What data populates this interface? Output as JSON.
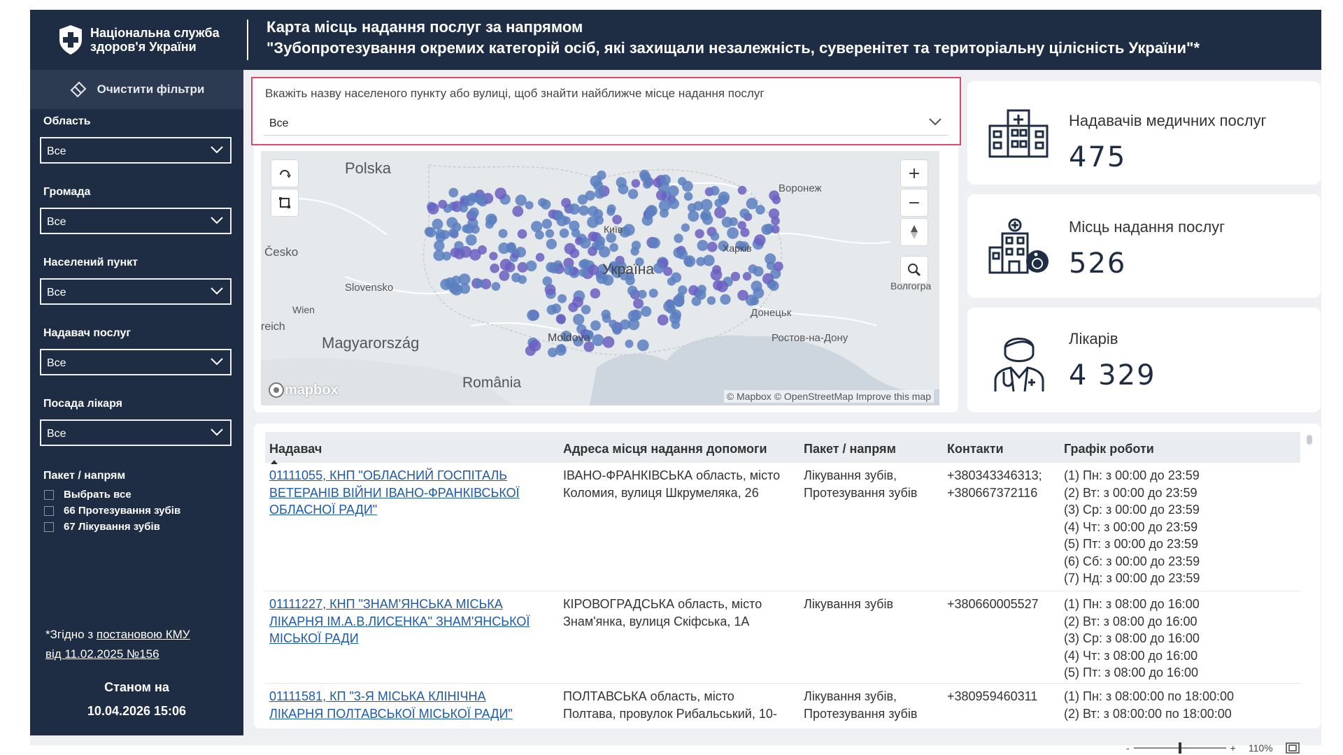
{
  "header": {
    "org_name_line1": "Національна служба",
    "org_name_line2": "здоров'я України",
    "title_line1": "Карта місць надання послуг за напрямом",
    "title_line2": "\"Зубопротезування окремих категорій осіб, які захищали незалежність, суверенітет та територіальну цілісність України\"*"
  },
  "sidebar": {
    "clear_filters": "Очистити фільтри",
    "filters": [
      {
        "label": "Область",
        "value": "Все"
      },
      {
        "label": "Громада",
        "value": "Все"
      },
      {
        "label": "Населений пункт",
        "value": "Все"
      },
      {
        "label": "Надавач послуг",
        "value": "Все"
      },
      {
        "label": "Посада лікаря",
        "value": "Все"
      }
    ],
    "package_label": "Пакет / напрям",
    "package_options": [
      "Выбрать все",
      "66 Протезування зубів",
      "67 Лікування зубів"
    ],
    "note_prefix": "*Згідно з ",
    "note_link_line1": "постановою КМУ",
    "note_link_line2": "від 11.02.2025 №156",
    "asof_label": "Станом на",
    "asof_value": "10.04.2026 15:06"
  },
  "search": {
    "label": "Вкажіть назву населеного пункту або вулиці, щоб знайти найближче місце надання послуг",
    "value": "Все"
  },
  "map": {
    "labels": [
      "Polska",
      "Česko",
      "Slovensko",
      "Wien",
      "reich",
      "Magyarország",
      "România",
      "Moldova",
      "Україна",
      "Київ",
      "Харків",
      "Воронеж",
      "Донецьк",
      "Ростов-на-Дону",
      "Волгогра"
    ],
    "attribution": "© Mapbox © OpenStreetMap  Improve this map",
    "brand": "mapbox",
    "dot_color": "#5b7fbf",
    "dot_color_alt": "#6a5fc2"
  },
  "kpis": [
    {
      "label": "Надавачів медичних послуг",
      "value": "475",
      "icon": "hospital-icon"
    },
    {
      "label": "Місць надання послуг",
      "value": "526",
      "icon": "clinic-accessible-icon"
    },
    {
      "label": "Лікарів",
      "value": "4 329",
      "icon": "doctor-icon"
    }
  ],
  "table": {
    "columns": [
      "Надавач",
      "Адреса місця надання допомоги",
      "Пакет / напрям",
      "Контакти",
      "Графік роботи"
    ],
    "rows": [
      {
        "provider": [
          "01111055, КНП \"ОБЛАСНИЙ ГОСПІТАЛЬ",
          "ВЕТЕРАНІВ ВІЙНИ ІВАНО-ФРАНКІВСЬКОЇ",
          "ОБЛАСНОЇ РАДИ\""
        ],
        "address": [
          "ІВАНО-ФРАНКІВСЬКА область, місто",
          "Коломия, вулиця Шкрумеляка, 26"
        ],
        "package": [
          "Лікування зубів,",
          "Протезування зубів"
        ],
        "contacts": [
          "+380343346313;",
          "+380667372116"
        ],
        "schedule": [
          "(1) Пн: з 00:00 до 23:59",
          "(2) Вт: з 00:00 до 23:59",
          "(3) Ср: з 00:00 до 23:59",
          "(4) Чт: з 00:00 до 23:59",
          "(5) Пт: з 00:00 до 23:59",
          "(6) Сб: з 00:00 до 23:59",
          "(7) Нд: з 00:00 до 23:59"
        ]
      },
      {
        "provider": [
          "01111227, КНП \"ЗНАМ'ЯНСЬКА МІСЬКА",
          "ЛІКАРНЯ ІМ.А.В.ЛИСЕНКА\" ЗНАМ'ЯНСЬКОЇ",
          "МІСЬКОЇ РАДИ"
        ],
        "address": [
          "КІРОВОГРАДСЬКА область, місто",
          "Знам'янка, вулиця Скіфська, 1А"
        ],
        "package": [
          "Лікування зубів"
        ],
        "contacts": [
          "+380660005527"
        ],
        "schedule": [
          "(1) Пн: з 08:00 до 16:00",
          "(2) Вт: з 08:00 до 16:00",
          "(3) Ср: з 08:00 до 16:00",
          "(4) Чт: з 08:00 до 16:00",
          "(5) Пт: з 08:00 до 16:00"
        ]
      },
      {
        "provider": [
          "01111581, КП \"3-Я МІСЬКА КЛІНІЧНА",
          "ЛІКАРНЯ ПОЛТАВСЬКОЇ МІСЬКОЇ РАДИ\""
        ],
        "address": [
          "ПОЛТАВСЬКА область, місто",
          "Полтава, провулок Рибальський, 10-"
        ],
        "package": [
          "Лікування зубів,",
          "Протезування зубів"
        ],
        "contacts": [
          "+380959460311"
        ],
        "schedule": [
          "(1) Пн: з 08:00:00 по 18:00:00",
          "(2) Вт: з 08:00:00 по 18:00:00"
        ]
      }
    ]
  },
  "status": {
    "zoom_minus": "-",
    "zoom_plus": "+",
    "zoom_value": "110%"
  }
}
